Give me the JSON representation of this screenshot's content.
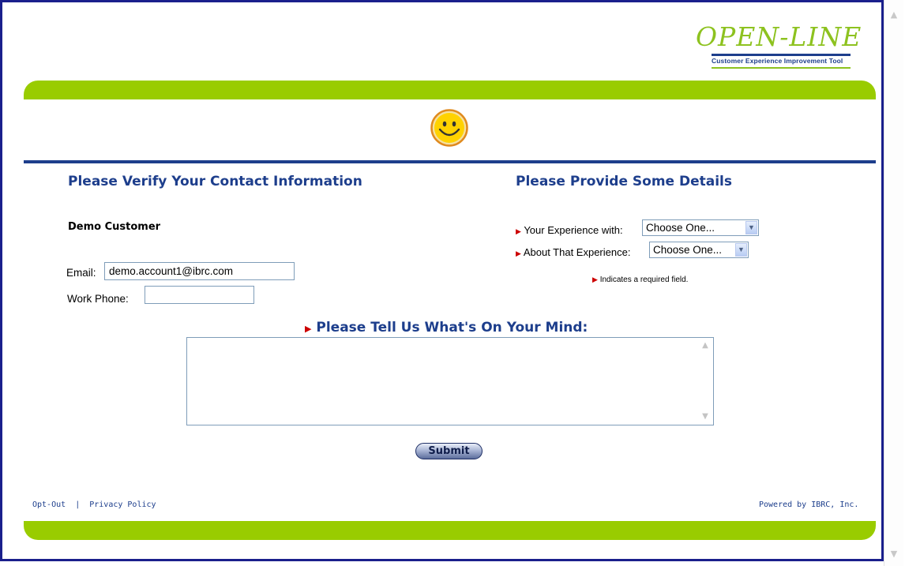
{
  "brand": {
    "logo_word": "OPEN-LINE",
    "tagline": "Customer Experience Improvement Tool",
    "green": "#99cc00",
    "blue": "#1d3e8c",
    "smiley_icon": "smiley-face"
  },
  "contact": {
    "heading": "Please Verify Your Contact Information",
    "customer_name": "Demo Customer",
    "email_label": "Email:",
    "email_value": "demo.account1@ibrc.com",
    "phone_label": "Work Phone:",
    "phone_value": ""
  },
  "details": {
    "heading": "Please Provide Some Details",
    "experience_label": "Your Experience with:",
    "experience_value": "Choose One...",
    "about_label": "About That Experience:",
    "about_value": "Choose One...",
    "required_note": "Indicates a required field."
  },
  "comments": {
    "heading": "Please Tell Us What's On Your Mind:",
    "value": ""
  },
  "submit_label": "Submit",
  "footer": {
    "opt_out": "Opt-Out",
    "separator": "|",
    "privacy": "Privacy Policy",
    "powered": "Powered by IBRC, Inc."
  }
}
